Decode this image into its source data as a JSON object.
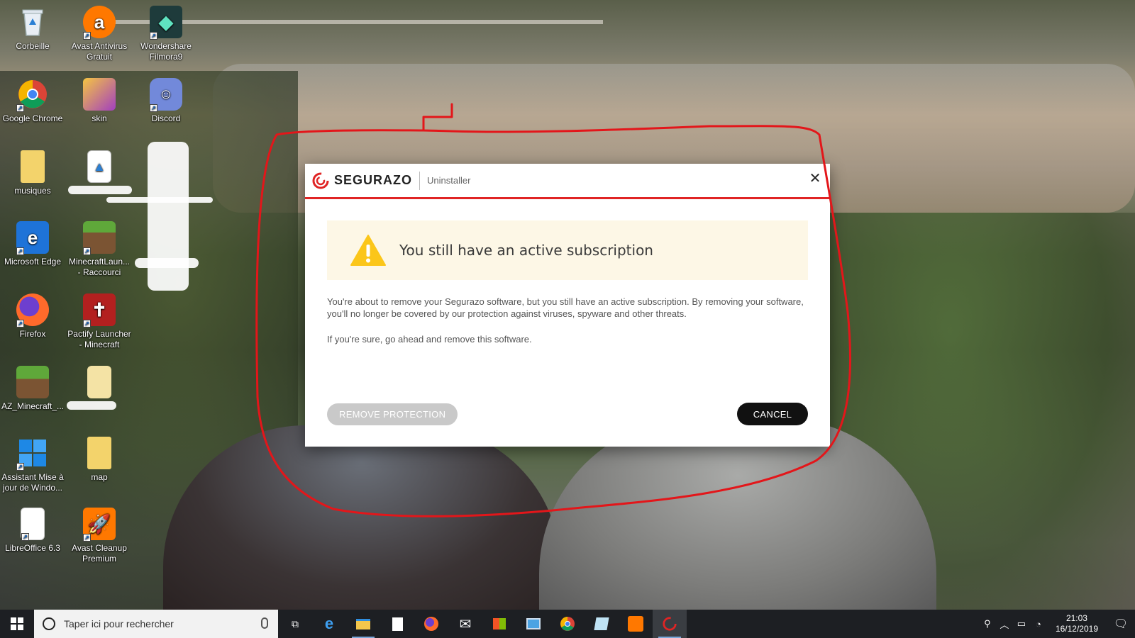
{
  "desktop": {
    "icons": [
      {
        "label": "Corbeille",
        "icon": "recycle-bin-icon"
      },
      {
        "label": "Avast Antivirus Gratuit",
        "icon": "avast-icon"
      },
      {
        "label": "Wondershare Filmora9",
        "icon": "filmora-icon"
      },
      {
        "label": "Google Chrome",
        "icon": "chrome-icon"
      },
      {
        "label": "skin",
        "icon": "image-file-icon"
      },
      {
        "label": "Discord",
        "icon": "discord-icon"
      },
      {
        "label": "musiques",
        "icon": "folder-icon"
      },
      {
        "label": "Microsoft Edge",
        "icon": "edge-icon"
      },
      {
        "label": "MinecraftLaun... - Raccourci",
        "icon": "minecraft-icon"
      },
      {
        "label": "Firefox",
        "icon": "firefox-icon"
      },
      {
        "label": "Pactify Launcher - Minecraft",
        "icon": "pactify-icon"
      },
      {
        "label": "AZ_Minecraft_...",
        "icon": "minecraft-block-icon"
      },
      {
        "label": "Assistant Mise à jour de Windo...",
        "icon": "windows-update-icon"
      },
      {
        "label": "map",
        "icon": "folder-icon"
      },
      {
        "label": "LibreOffice 6.3",
        "icon": "libreoffice-icon"
      },
      {
        "label": "Avast Cleanup Premium",
        "icon": "avast-cleanup-icon"
      }
    ]
  },
  "dialog": {
    "brand": "SEGURAZO",
    "subtitle": "Uninstaller",
    "close_label": "✕",
    "alert_title": "You still have an active subscription",
    "paragraph1": "You're about to remove your Segurazo software, but you still have an active subscription. By removing your software, you'll no longer be covered by our protection against viruses, spyware and other threats.",
    "paragraph2": "If you're sure, go ahead and remove this software.",
    "remove_label": "REMOVE PROTECTION",
    "cancel_label": "CANCEL",
    "accent_color": "#e02424"
  },
  "taskbar": {
    "search_placeholder": "Taper ici pour rechercher",
    "apps": [
      "task-view-icon",
      "edge-icon",
      "file-explorer-icon",
      "notepad-icon",
      "firefox-icon",
      "mail-icon",
      "store-icon",
      "control-panel-icon",
      "chrome-icon",
      "notes-icon",
      "avast-icon",
      "segurazo-icon"
    ],
    "time": "21:03",
    "date": "16/12/2019"
  }
}
